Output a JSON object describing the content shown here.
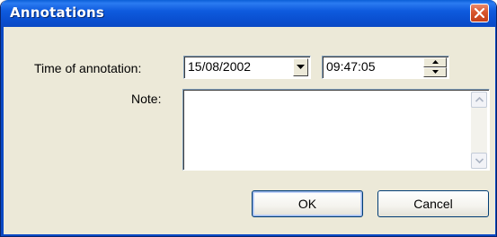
{
  "window": {
    "title": "Annotations"
  },
  "form": {
    "time_label": "Time of annotation:",
    "date_value": "15/08/2002",
    "time_value": "09:47:05",
    "note_label": "Note:",
    "note_value": ""
  },
  "buttons": {
    "ok_label": "OK",
    "cancel_label": "Cancel"
  },
  "icons": {
    "close": "close-icon",
    "dropdown": "chevron-down-icon",
    "spin_up": "spin-up-icon",
    "spin_down": "spin-down-icon",
    "scroll_up": "scroll-up-icon",
    "scroll_down": "scroll-down-icon"
  },
  "colors": {
    "titlebar": "#0a4fd0",
    "close_button": "#d8562e",
    "dialog_background": "#ece9d8"
  }
}
